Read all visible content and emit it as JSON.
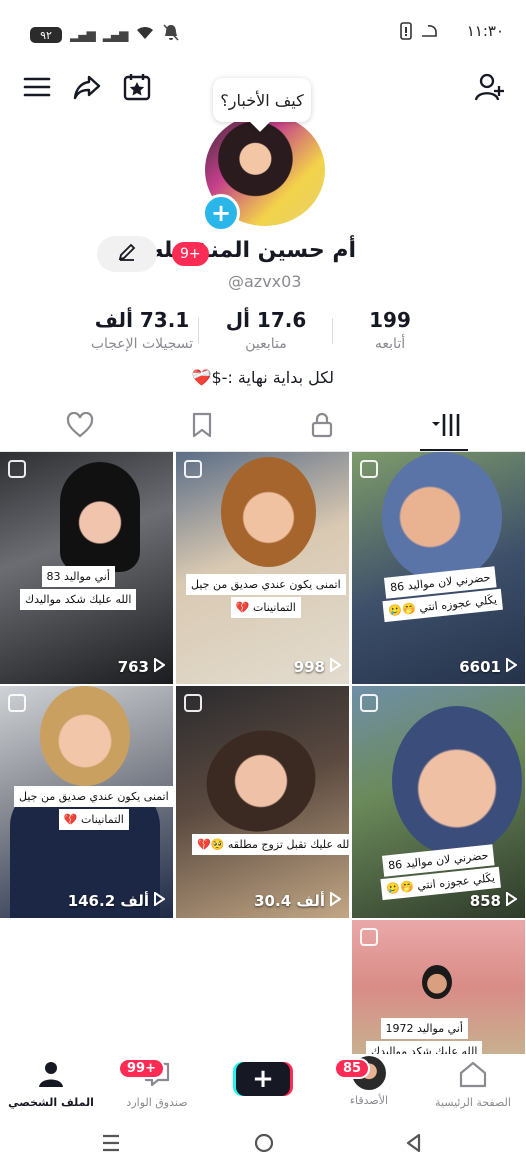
{
  "status_bar": {
    "time": "١١:٣٠",
    "battery": "٩٢",
    "signal_1": "4G",
    "signal_2": "4G"
  },
  "top_bar": {
    "menu_icon": "hamburger-menu-icon",
    "share_icon": "share-arrow-icon",
    "calendar_icon": "calendar-star-icon",
    "add_friend_icon": "add-person-icon",
    "bubble_text": "كيف الأخبار؟"
  },
  "profile": {
    "name": "أم حسين المنفصله",
    "badge": "9+",
    "handle": "@azvx03",
    "bio": "لكل بداية نهاية :-$❤️‍🩹",
    "stats": {
      "likes_num": "73.1 ألف",
      "likes_lbl": "تسجيلات الإعجاب",
      "followers_num": "17.6 أل",
      "followers_lbl": "متابعين",
      "following_num": "199",
      "following_lbl": "أتابعه"
    }
  },
  "tabs": [
    "videos-grid",
    "private-lock",
    "saved-bookmark",
    "liked-heart"
  ],
  "videos": [
    {
      "views": "763",
      "caption": [
        "أني مواليد 83",
        "الله عليك شكد مواليدك"
      ]
    },
    {
      "views": "998",
      "caption": [
        "اتمنى يكون عندي صديق من جيل",
        "التمانينات 💔"
      ]
    },
    {
      "views": "6601",
      "caption": [
        "حضرني لان مواليد 86",
        "يكَلي عجوزه انتي 🤭🥲"
      ]
    },
    {
      "views": "146.2 ألف",
      "caption": [
        "اتمنى يكون عندي صديق من جيل",
        "التمانينات 💔"
      ]
    },
    {
      "views": "30.4 ألف",
      "caption": [
        "الله عليك تقبل تزوج مطلقه 🥺💔"
      ]
    },
    {
      "views": "858",
      "caption": [
        "حضرني لان مواليد 86",
        "يكَلي عجوزه انتي 🤭🥲"
      ]
    },
    {
      "views": "",
      "caption": [
        "أني مواليد 1972",
        "الله عليك شكد مواليدك"
      ]
    }
  ],
  "bottom_nav": {
    "home": "الصفحة الرئيسية",
    "friends": "الأصدقاء",
    "friends_badge": "85",
    "inbox": "صندوق الوارد",
    "inbox_badge": "99+",
    "profile": "الملف الشخصي"
  }
}
